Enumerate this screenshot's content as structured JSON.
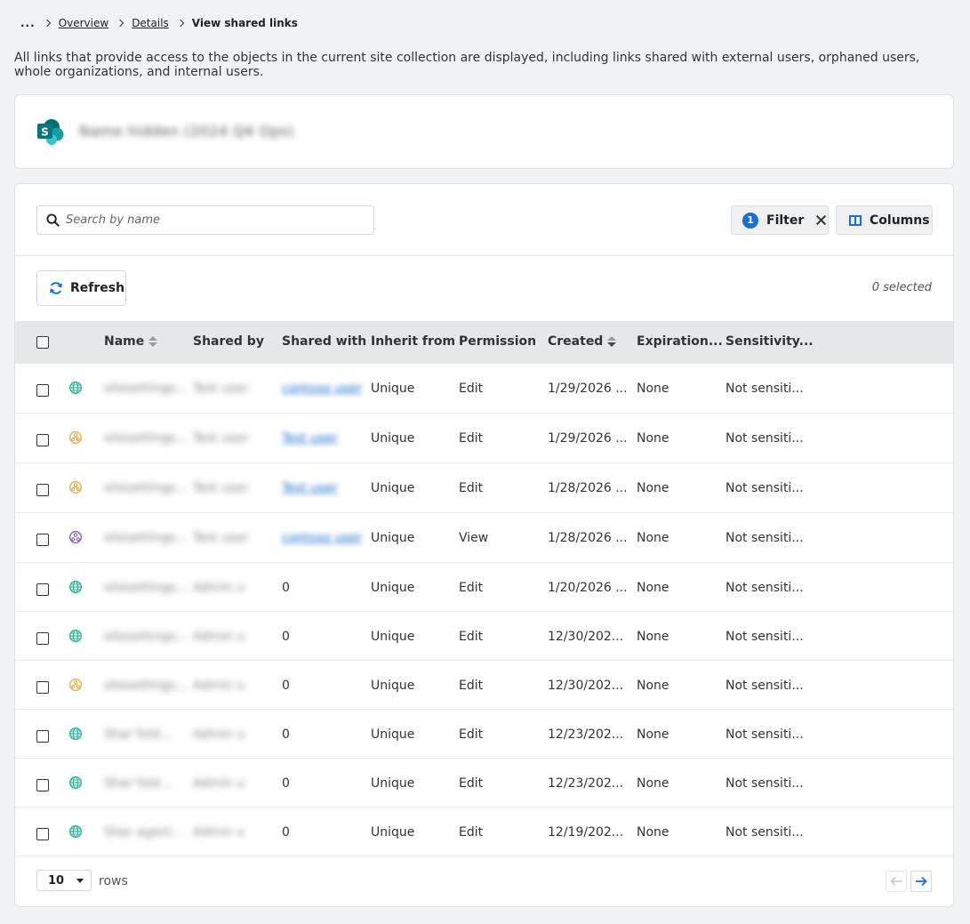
{
  "breadcrumb": {
    "ellipsis": "...",
    "items": [
      "Overview",
      "Details"
    ],
    "current": "View shared links"
  },
  "description": "All links that provide access to the objects in the current site collection are displayed, including links shared with external users, orphaned users, whole organizations, and internal users.",
  "site": {
    "name": "Name hidden (2024 Q4 Ops)",
    "icon": "sharepoint-icon"
  },
  "toolbar": {
    "search_placeholder": "Search by name",
    "filter_count": "1",
    "filter_label": "Filter",
    "columns_label": "Columns",
    "refresh_label": "Refresh",
    "selected_text": "0 selected"
  },
  "columns": [
    "Name",
    "Shared by",
    "Shared with",
    "Inherit from",
    "Permission",
    "Created",
    "Expiration...",
    "Sensitivity..."
  ],
  "rows": [
    {
      "icon": "globe",
      "name": "sitesettings...",
      "shared_by": "Test user",
      "shared_with": "contoso user",
      "shared_with_is_link": true,
      "inherit": "Unique",
      "permission": "Edit",
      "created": "1/29/2026 ...",
      "expiration": "None",
      "sensitivity": "Not sensiti..."
    },
    {
      "icon": "org",
      "name": "sitesettings...",
      "shared_by": "Test user",
      "shared_with": "Test user",
      "shared_with_is_link": true,
      "inherit": "Unique",
      "permission": "Edit",
      "created": "1/29/2026 ...",
      "expiration": "None",
      "sensitivity": "Not sensiti..."
    },
    {
      "icon": "org",
      "name": "sitesettings...",
      "shared_by": "Test user",
      "shared_with": "Test user",
      "shared_with_is_link": true,
      "inherit": "Unique",
      "permission": "Edit",
      "created": "1/28/2026 ...",
      "expiration": "None",
      "sensitivity": "Not sensiti..."
    },
    {
      "icon": "people",
      "name": "sitesettings...",
      "shared_by": "Test user",
      "shared_with": "contoso user",
      "shared_with_is_link": true,
      "inherit": "Unique",
      "permission": "View",
      "created": "1/28/2026 ...",
      "expiration": "None",
      "sensitivity": "Not sensiti..."
    },
    {
      "icon": "globe",
      "name": "sitesettings...",
      "shared_by": "Admin u",
      "shared_with": "0",
      "shared_with_is_link": false,
      "inherit": "Unique",
      "permission": "Edit",
      "created": "1/20/2026 ...",
      "expiration": "None",
      "sensitivity": "Not sensiti..."
    },
    {
      "icon": "globe",
      "name": "sitesettings...",
      "shared_by": "Admin u",
      "shared_with": "0",
      "shared_with_is_link": false,
      "inherit": "Unique",
      "permission": "Edit",
      "created": "12/30/202...",
      "expiration": "None",
      "sensitivity": "Not sensiti..."
    },
    {
      "icon": "org",
      "name": "sitesettings...",
      "shared_by": "Admin u",
      "shared_with": "0",
      "shared_with_is_link": false,
      "inherit": "Unique",
      "permission": "Edit",
      "created": "12/30/202...",
      "expiration": "None",
      "sensitivity": "Not sensiti..."
    },
    {
      "icon": "globe",
      "name": "Shar fold...",
      "shared_by": "Admin u",
      "shared_with": "0",
      "shared_with_is_link": false,
      "inherit": "Unique",
      "permission": "Edit",
      "created": "12/23/202...",
      "expiration": "None",
      "sensitivity": "Not sensiti..."
    },
    {
      "icon": "globe",
      "name": "Shar fold...",
      "shared_by": "Admin u",
      "shared_with": "0",
      "shared_with_is_link": false,
      "inherit": "Unique",
      "permission": "Edit",
      "created": "12/23/202...",
      "expiration": "None",
      "sensitivity": "Not sensiti..."
    },
    {
      "icon": "globe",
      "name": "Shar ageni...",
      "shared_by": "Admin u",
      "shared_with": "0",
      "shared_with_is_link": false,
      "inherit": "Unique",
      "permission": "Edit",
      "created": "12/19/202...",
      "expiration": "None",
      "sensitivity": "Not sensiti..."
    }
  ],
  "footer": {
    "page_size": "10",
    "rows_label": "rows"
  },
  "colors": {
    "accent": "#1a6fd0",
    "globe": "#2bb39a",
    "org": "#f0a94a",
    "people": "#8a5bb8"
  }
}
